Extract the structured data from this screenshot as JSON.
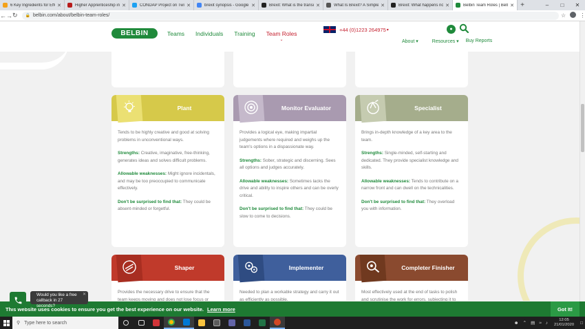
{
  "browser": {
    "tabs": [
      {
        "label": "6 Key Ingredients for Effecti",
        "color": "#f4a21a",
        "active": false
      },
      {
        "label": "Higher Apprenticeship in S",
        "color": "#b71c1c",
        "active": false
      },
      {
        "label": "CONDAP Project on Twitter",
        "color": "#1da1f2",
        "active": false
      },
      {
        "label": "brexit synopsis - Google Se",
        "color": "#4285f4",
        "active": false
      },
      {
        "label": "Brexit: What is the transitio",
        "color": "#222222",
        "active": false
      },
      {
        "label": "What Is Brexit? A Simple G",
        "color": "#555555",
        "active": false
      },
      {
        "label": "Brexit: What happens now?",
        "color": "#222222",
        "active": false
      },
      {
        "label": "Belbin Team Roles | Belbin",
        "color": "#1f8a3b",
        "active": true
      }
    ],
    "url": "belbin.com/about/belbin-team-roles/"
  },
  "site": {
    "logo": "BELBIN",
    "nav": [
      "Teams",
      "Individuals",
      "Training",
      "Team Roles"
    ],
    "phone": "+44 (0)1223 264975",
    "subnav": [
      "About",
      "Resources",
      "Buy Reports"
    ]
  },
  "cards": [
    {
      "title": "Plant",
      "color": "#d6c94a",
      "icon_color": "#ebe073",
      "icon": "lightbulb-icon",
      "description": "Tends to be highly creative and good at solving problems in unconventional ways.",
      "strengths_label": "Strengths:",
      "strengths": "Creative, imaginative, free-thinking, generates ideas and solves difficult problems.",
      "weaknesses_label": "Allowable weaknesses:",
      "weaknesses": "Might ignore incidentals, and may be too preoccupied to communicate effectively.",
      "surprise_label": "Don't be surprised to find that:",
      "surprise": "They could be absent-minded or forgetful."
    },
    {
      "title": "Monitor Evaluator",
      "color": "#a99ab0",
      "icon_color": "#c5b9cb",
      "icon": "eye-icon",
      "description": "Provides a logical eye, making impartial judgements where required and weighs up the team's options in a dispassionate way.",
      "strengths_label": "Strengths:",
      "strengths": "Sober, strategic and discerning. Sees all options and judges accurately.",
      "weaknesses_label": "Allowable weaknesses:",
      "weaknesses": "Sometimes lacks the drive and ability to inspire others and can be overly critical.",
      "surprise_label": "Don't be surprised to find that:",
      "surprise": "They could be slow to come to decisions."
    },
    {
      "title": "Specialist",
      "color": "#a5ad8c",
      "icon_color": "#c5cbb0",
      "icon": "specialist-icon",
      "description": "Brings in-depth knowledge of a key area to the team.",
      "strengths_label": "Strengths:",
      "strengths": "Single-minded, self-starting and dedicated. They provide specialist knowledge and skills.",
      "weaknesses_label": "Allowable weaknesses:",
      "weaknesses": "Tends to contribute on a narrow front and can dwell on the technicalities.",
      "surprise_label": "Don't be surprised to find that:",
      "surprise": "They overload you with information."
    },
    {
      "title": "Shaper",
      "color": "#c03a2b",
      "icon_color": "#a82e21",
      "icon": "shaper-icon",
      "description": "Provides the necessary drive to ensure that the team keeps moving and does not lose focus or"
    },
    {
      "title": "Implementer",
      "color": "#3f5f9c",
      "icon_color": "#2f4c82",
      "icon": "gears-icon",
      "description": "Needed to plan a workable strategy and carry it out as efficiently as possible."
    },
    {
      "title": "Completer Finisher",
      "color": "#8a4a2f",
      "icon_color": "#70391f",
      "icon": "magnifier-icon",
      "description": "Most effectively used at the end of tasks to polish and scrutinise the work for errors, subjecting it to"
    }
  ],
  "chat": {
    "text": "Would you like a free callback in 27 seconds?"
  },
  "cookie": {
    "message": "This website uses cookies to ensure you get the best experience on our website.",
    "learn_more": "Learn more",
    "button": "Got It!"
  },
  "taskbar": {
    "search_placeholder": "Type here to search",
    "time": "12:05",
    "date": "21/01/2020"
  }
}
